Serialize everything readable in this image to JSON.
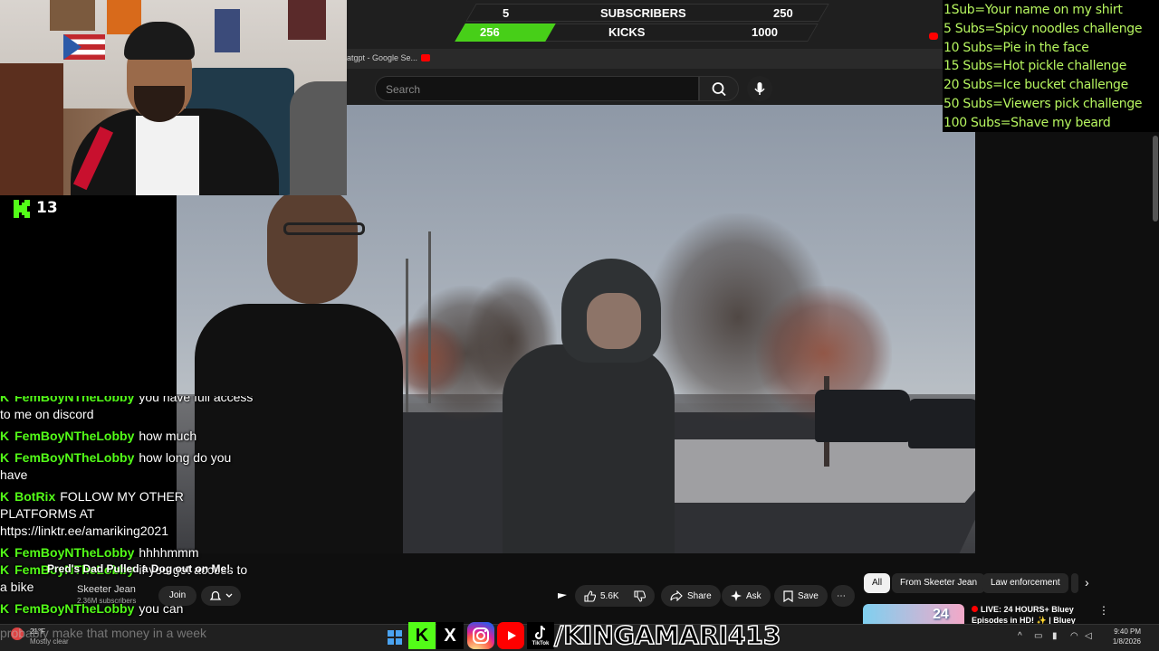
{
  "goal_bar": {
    "subscribers_current": "5",
    "subscribers_label": "SUBSCRIBERS",
    "subscribers_target": "250",
    "kicks_current": "256",
    "kicks_label": "KICKS",
    "kicks_target": "1000",
    "kicks_progress": 0.256,
    "accent_color": "#53fc18"
  },
  "browser": {
    "tab_title": "atgpt - Google Se...",
    "search_placeholder": "Search",
    "search_icon": "search-icon",
    "mic_icon": "mic-icon"
  },
  "rules": [
    "1Sub=Your name on my shirt",
    "5 Subs=Spicy noodles challenge",
    "10 Subs=Pie in the face",
    "15 Subs=Hot pickle challenge",
    "20 Subs=Ice bucket challenge",
    "50 Subs=Viewers pick challenge",
    "100 Subs=Shave my beard"
  ],
  "kick_counter": {
    "icon": "kick-logo-icon",
    "count": "13"
  },
  "chat": [
    {
      "user": "FemBoyNTheLobby",
      "message": "you have full access to me on discord"
    },
    {
      "user": "FemBoyNTheLobby",
      "message": "how much"
    },
    {
      "user": "FemBoyNTheLobby",
      "message": "how long do you have"
    },
    {
      "user": "BotRix",
      "message": "FOLLOW MY OTHER PLATFORMS AT https://linktr.ee/amariking2021"
    },
    {
      "user": "FemBoyNTheLobby",
      "message": "hhhhmmm"
    },
    {
      "user": "FemBoyNTheLobby",
      "message": "if you get access to a bike"
    },
    {
      "user": "FemBoyNTheLobby",
      "message": "you can"
    }
  ],
  "chat_tail": "probably make that money in a week",
  "video": {
    "title": "Pred's Dad Pulled a Dog out on Me!",
    "channel_name": "Skeeter Jean",
    "channel_subscribers": "2.36M subscribers",
    "join_label": "Join",
    "bell_icon": "bell-icon",
    "like_count": "5.6K",
    "share_label": "Share",
    "ask_label": "Ask",
    "save_label": "Save"
  },
  "chips": [
    "All",
    "From Skeeter Jean",
    "Law enforcement"
  ],
  "recommendation": {
    "title": "LIVE: 24 HOURS+ Bluey Episodes in HD! ✨ | Bluey",
    "badge": "24"
  },
  "taskbar": {
    "weather_temp": "21°F",
    "weather_desc": "Mostly clear",
    "social_handle": "/KINGAMARI413",
    "social_icons": [
      "kick-icon",
      "x-icon",
      "instagram-icon",
      "youtube-icon",
      "tiktok-icon"
    ],
    "tiktok_label": "TikTok",
    "time": "9:40 PM",
    "date": "1/8/2026"
  }
}
